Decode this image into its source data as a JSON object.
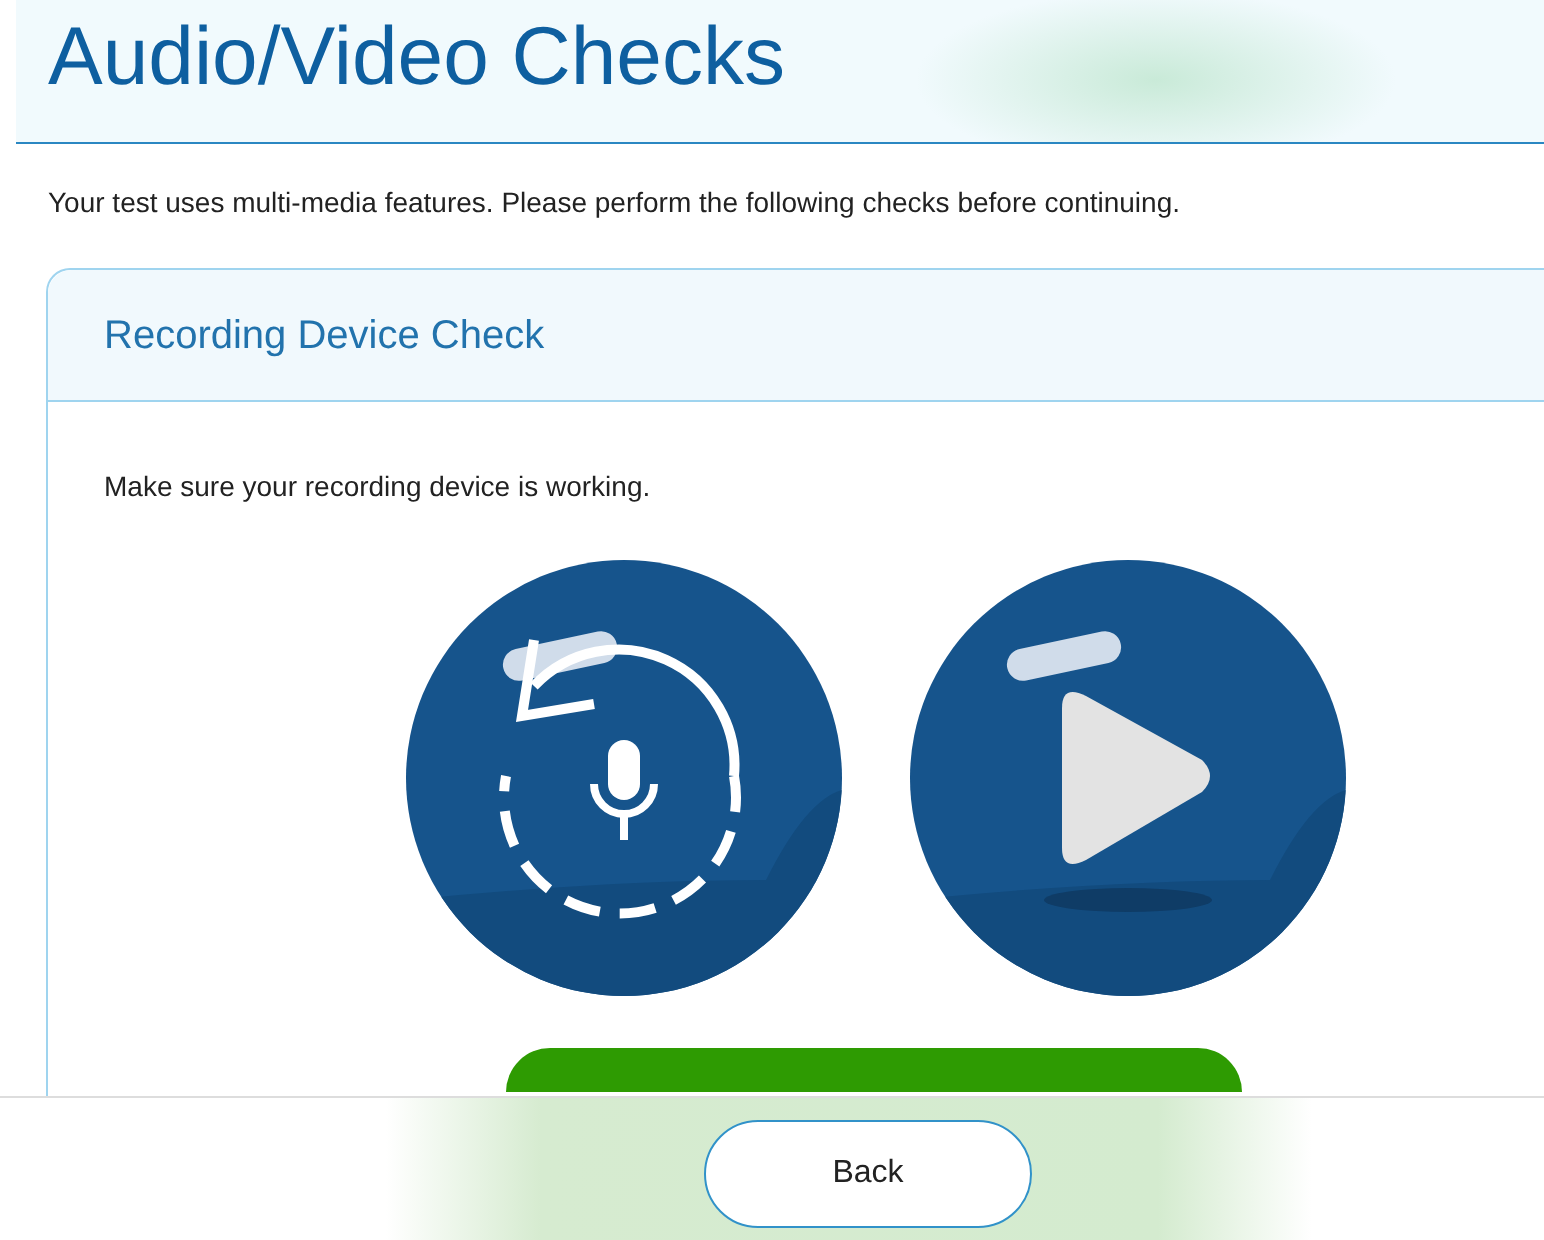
{
  "page": {
    "title": "Audio/Video Checks",
    "intro": "Your test uses multi-media features. Please perform the following checks before continuing."
  },
  "section": {
    "title": "Recording Device Check",
    "instruction": "Make sure your recording device is working."
  },
  "footer": {
    "back_button": "Back"
  }
}
